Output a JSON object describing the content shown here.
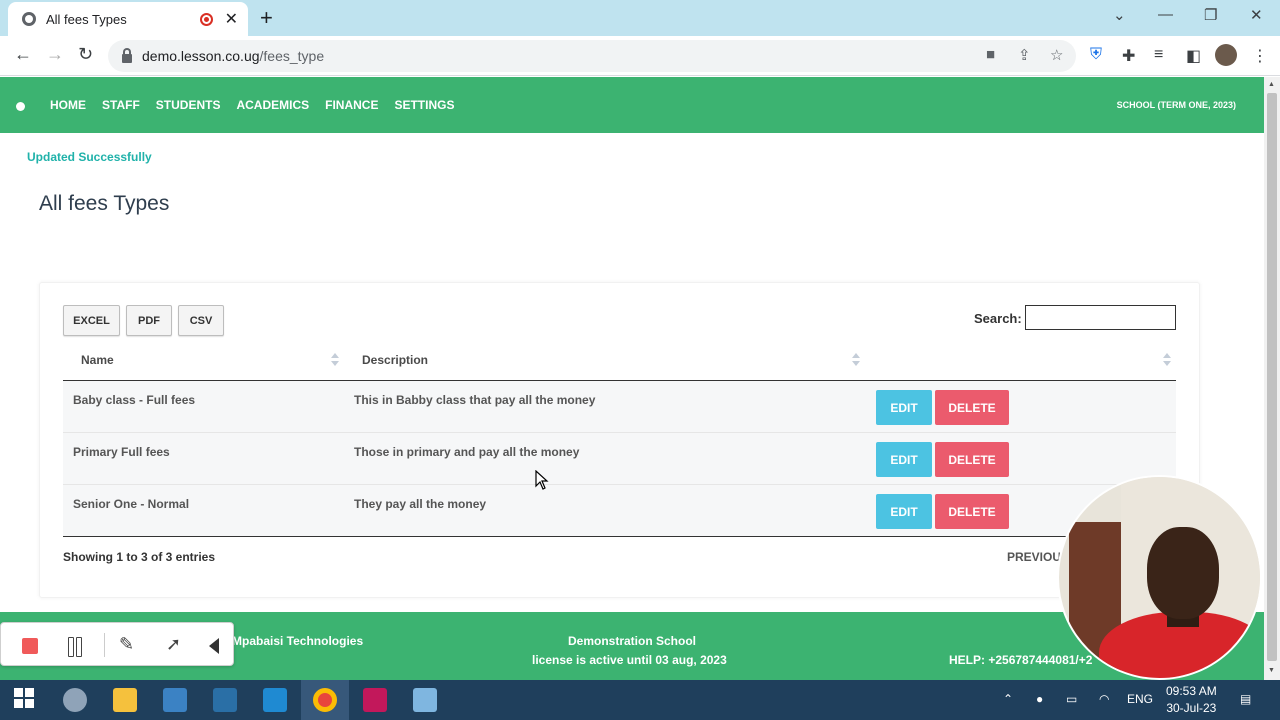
{
  "browser": {
    "tab_title": "All fees Types",
    "url_host": "demo.lesson.co.ug",
    "url_path": "/fees_type"
  },
  "nav": {
    "menu": [
      "HOME",
      "STAFF",
      "STUDENTS",
      "ACADEMICS",
      "FINANCE",
      "SETTINGS"
    ],
    "school_term": "SCHOOL (TERM ONE, 2023)"
  },
  "flash_message": "Updated Successfully",
  "page_title": "All fees Types",
  "export_buttons": {
    "excel": "EXCEL",
    "pdf": "PDF",
    "csv": "CSV"
  },
  "search": {
    "label": "Search:",
    "value": ""
  },
  "table": {
    "headers": [
      "Name",
      "Description",
      ""
    ],
    "rows": [
      {
        "name": "Baby class - Full fees",
        "description": "This in Babby class that pay all the money"
      },
      {
        "name": "Primary Full fees",
        "description": "Those in primary and pay all the money"
      },
      {
        "name": "Senior One - Normal",
        "description": "They pay all the money"
      }
    ],
    "edit_label": "EDIT",
    "delete_label": "DELETE",
    "info": "Showing 1 to 3 of 3 entries",
    "previous": "PREVIOU"
  },
  "footer": {
    "company": "Mpabaisi Technologies",
    "school": "Demonstration School",
    "license": "license is active until 03 aug, 2023",
    "help": "HELP: +256787444081/+2"
  },
  "taskbar": {
    "lang": "ENG",
    "time": "09:53 AM",
    "date": "30-Jul-23"
  },
  "colors": {
    "brand_green": "#3cb371",
    "edit_blue": "#4cc3e2",
    "delete_red": "#eb5b6d",
    "flash_teal": "#20b2aa"
  }
}
